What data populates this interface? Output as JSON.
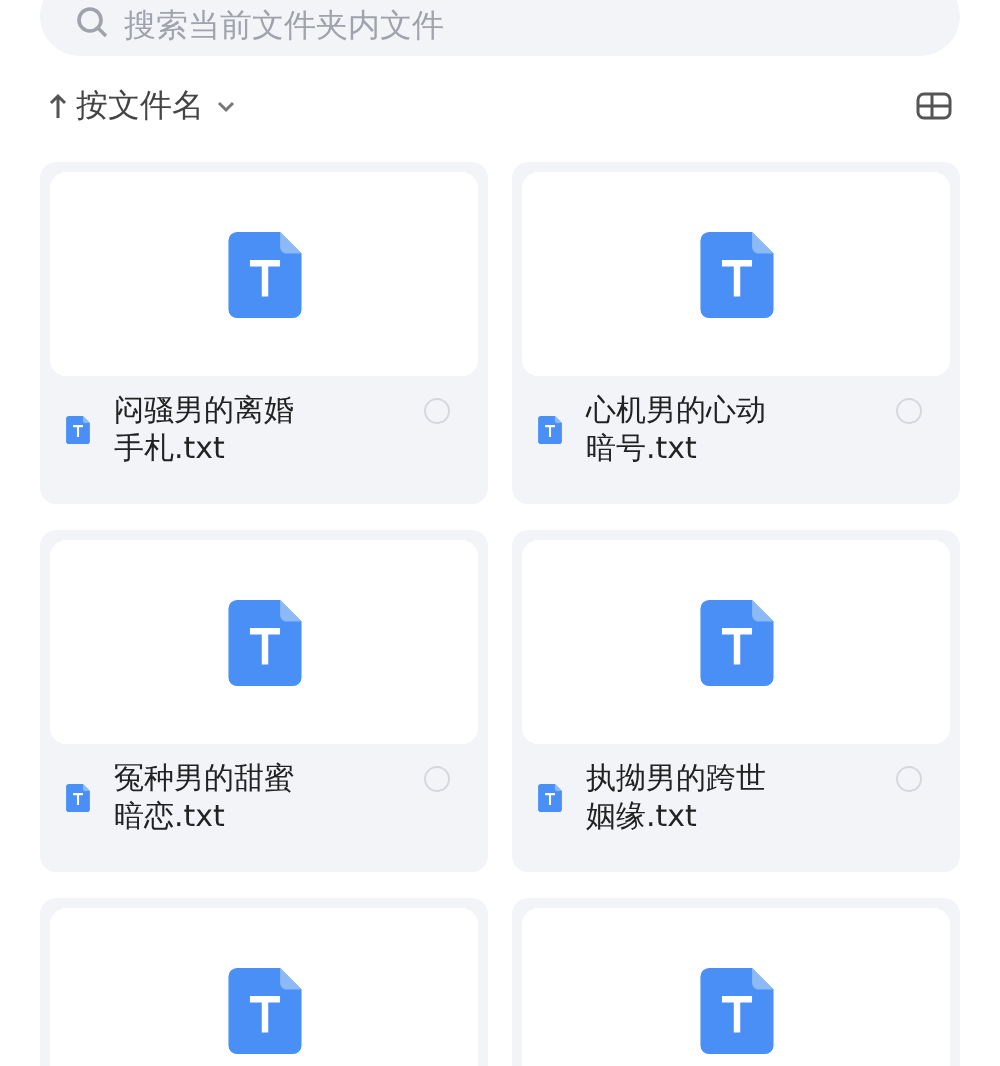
{
  "search": {
    "placeholder": "搜索当前文件夹内文件"
  },
  "sort": {
    "label": "按文件名"
  },
  "files": [
    {
      "kind": "named",
      "name": "闷骚男的离婚手札.txt",
      "selected": false
    },
    {
      "kind": "named",
      "name": "心机男的心动暗号.txt",
      "selected": false
    },
    {
      "kind": "named",
      "name": "冤种男的甜蜜暗恋.txt",
      "selected": false
    },
    {
      "kind": "named",
      "name": "执拗男的跨世姻缘.txt",
      "selected": false
    },
    {
      "kind": "preview"
    },
    {
      "kind": "preview"
    }
  ]
}
